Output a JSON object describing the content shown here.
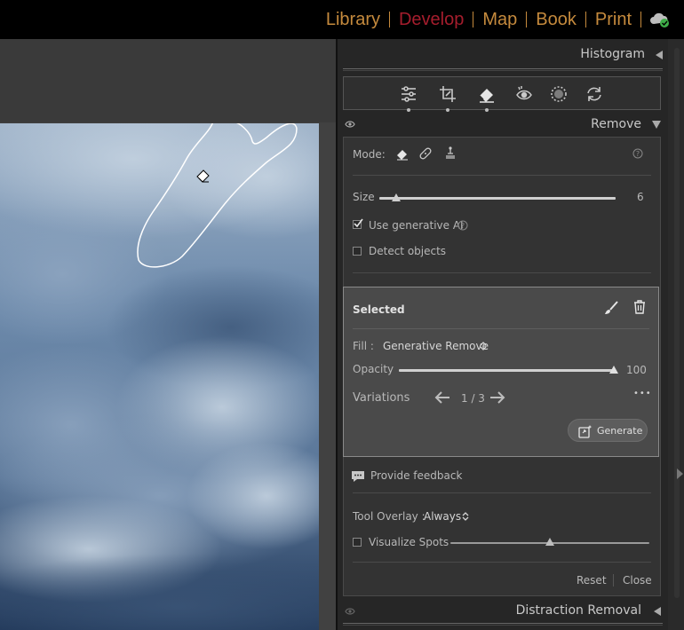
{
  "modules": {
    "library": "Library",
    "develop": "Develop",
    "map": "Map",
    "book": "Book",
    "print": "Print"
  },
  "panels": {
    "histogram": "Histogram",
    "remove": "Remove",
    "distraction_removal": "Distraction Removal"
  },
  "toolstrip": [
    "sliders-icon",
    "crop-icon",
    "eraser-icon",
    "red-eye-icon",
    "masking-icon",
    "reset-icon"
  ],
  "remove": {
    "mode_label": "Mode:",
    "size_label": "Size",
    "size_value": "6",
    "size_fraction": 0.07,
    "use_generative_ai": "Use generative AI",
    "use_generative_ai_checked": true,
    "detect_objects": "Detect objects",
    "detect_objects_checked": false
  },
  "selected": {
    "title": "Selected",
    "fill_label": "Fill :",
    "fill_value": "Generative Remove",
    "opacity_label": "Opacity",
    "opacity_value": "100",
    "opacity_fraction": 1.0,
    "variations_label": "Variations",
    "variations_value": "1 / 3",
    "more": "•••",
    "generate": "Generate"
  },
  "feedback": "Provide feedback",
  "tool_overlay_label": "Tool Overlay :",
  "tool_overlay_value": "Always",
  "visualize_spots": "Visualize Spots",
  "visualize_spots_fraction": 0.5,
  "reset": "Reset",
  "close": "Close",
  "colors": {
    "module_inactive": "#c58a3d",
    "module_active": "#a51d2d",
    "cloud_badge": "#3fae49"
  }
}
